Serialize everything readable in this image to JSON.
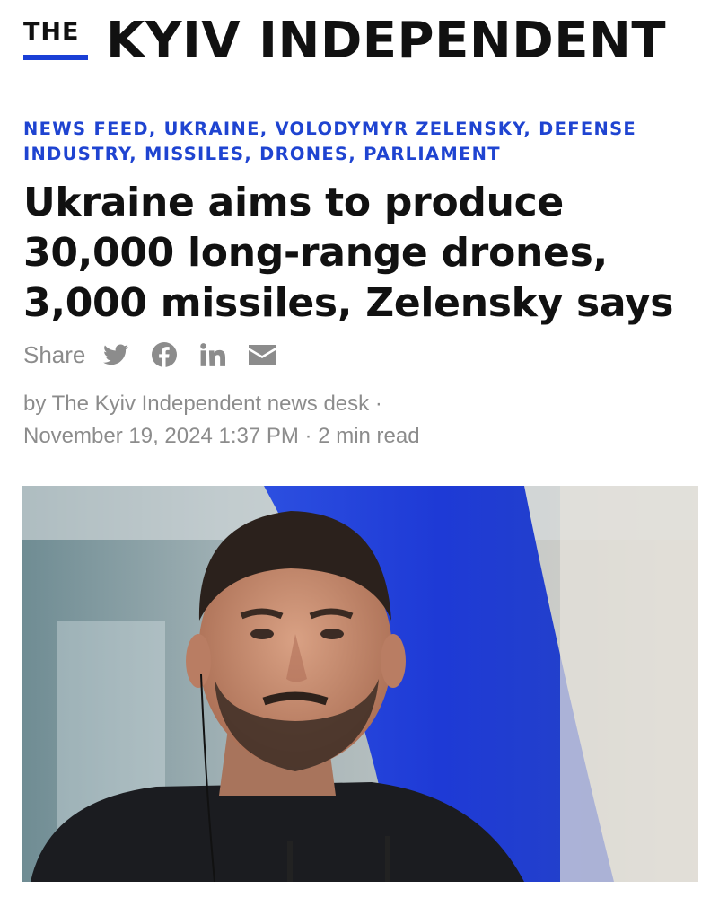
{
  "masthead": {
    "logo_prefix": "THE",
    "logo_name": "KYIV INDEPENDENT"
  },
  "tags": [
    "NEWS FEED",
    "UKRAINE",
    "VOLODYMYR ZELENSKY",
    "DEFENSE INDUSTRY",
    "MISSILES",
    "DRONES",
    "PARLIAMENT"
  ],
  "article": {
    "headline_lines": [
      "Ukraine aims to produce",
      "30,000 long-range drones,",
      "3,000 missiles, Zelensky says"
    ],
    "share_label": "Share",
    "share_icons": [
      "twitter-icon",
      "facebook-icon",
      "linkedin-icon",
      "email-icon"
    ],
    "byline_author": "by The Kyiv Independent news desk",
    "byline_date": "November 19, 2024 1:37 PM",
    "byline_read": "2 min read",
    "separator": "·"
  },
  "colors": {
    "accent": "#1f44d1",
    "text": "#111111",
    "muted": "#8c8c8c",
    "flag_blue": "#1e3ad6"
  }
}
